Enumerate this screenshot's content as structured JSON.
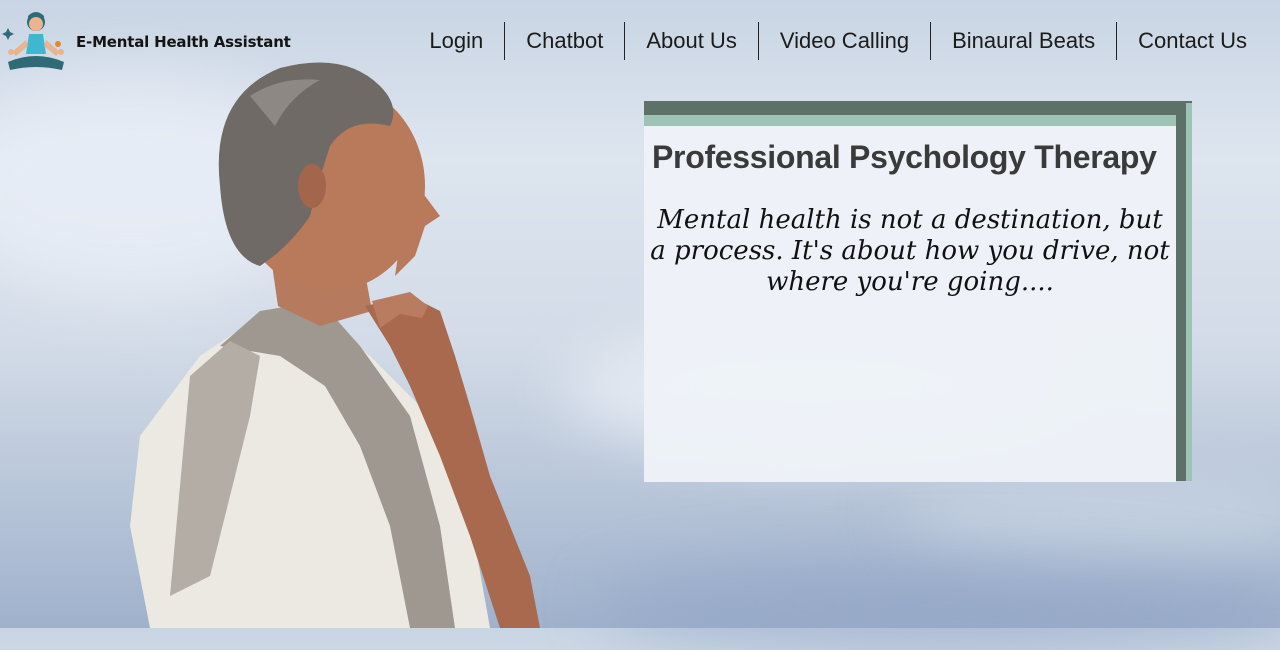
{
  "header": {
    "brand": "E-Mental Health Assistant",
    "nav": [
      {
        "label": "Login"
      },
      {
        "label": "Chatbot"
      },
      {
        "label": "About Us"
      },
      {
        "label": "Video Calling"
      },
      {
        "label": "Binaural Beats"
      },
      {
        "label": "Contact Us"
      }
    ]
  },
  "hero": {
    "title": "Professional Psychology Therapy",
    "quote": "Mental health is not a destination, but a process. It's about how you drive, not where you're going...."
  },
  "colors": {
    "card_dark": "#5d7169",
    "card_light": "#9ec3b6",
    "text": "#1b1b1b"
  }
}
